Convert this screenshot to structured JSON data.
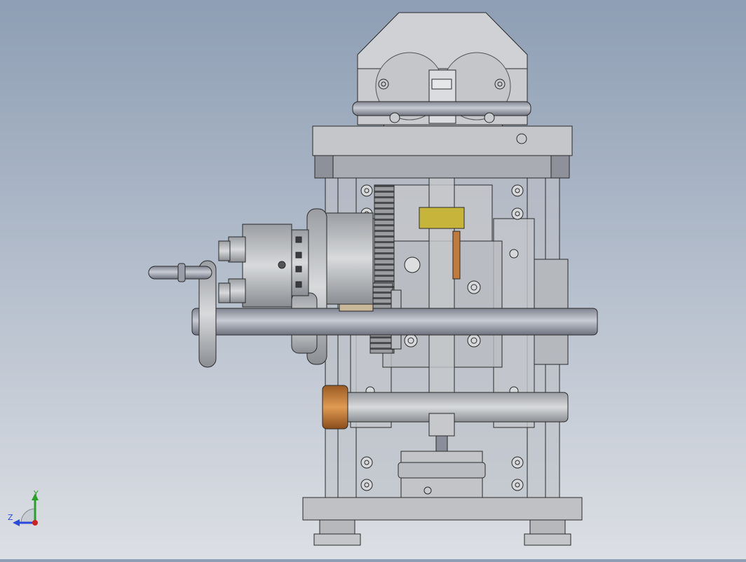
{
  "viewport": {
    "background_top": "#8e9eb4",
    "background_bottom": "#dcdfe4",
    "part_color": "#c8cacd",
    "edge_color": "#2a2a2a",
    "accent_yellow": "#c7b43a",
    "accent_copper": "#c07a3a"
  },
  "triad": {
    "y_label": "Y",
    "z_label": "Z",
    "y_color": "#2aa02a",
    "z_color": "#2a4adc",
    "x_color": "#d02020"
  }
}
